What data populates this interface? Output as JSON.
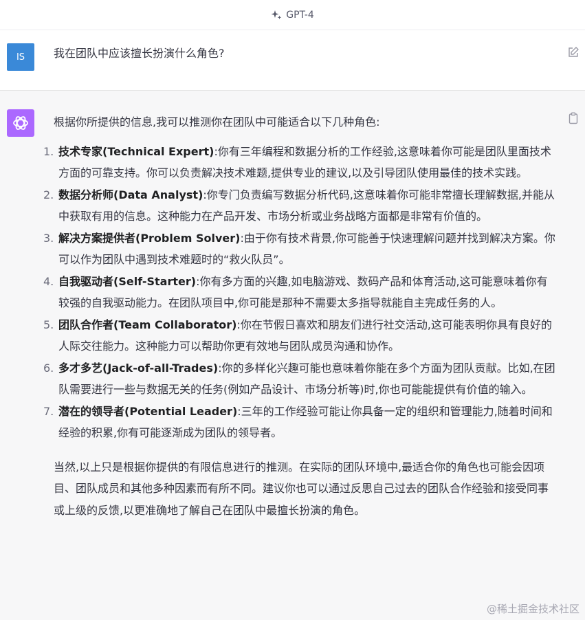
{
  "header": {
    "model_name": "GPT-4"
  },
  "user_message": {
    "avatar_initials": "IS",
    "text": "我在团队中应该擅长扮演什么角色?"
  },
  "assistant_message": {
    "intro": "根据你所提供的信息,我可以推测你在团队中可能适合以下几种角色:",
    "items": [
      {
        "num": "1.",
        "title": "技术专家(Technical Expert)",
        "text": ":你有三年编程和数据分析的工作经验,这意味着你可能是团队里面技术方面的可靠支持。你可以负责解决技术难题,提供专业的建议,以及引导团队使用最佳的技术实践。"
      },
      {
        "num": "2.",
        "title": "数据分析师(Data Analyst)",
        "text": ":你专门负责编写数据分析代码,这意味着你可能非常擅长理解数据,并能从中获取有用的信息。这种能力在产品开发、市场分析或业务战略方面都是非常有价值的。"
      },
      {
        "num": "3.",
        "title": "解决方案提供者(Problem Solver)",
        "text": ":由于你有技术背景,你可能善于快速理解问题并找到解决方案。你可以作为团队中遇到技术难题时的“救火队员”。"
      },
      {
        "num": "4.",
        "title": "自我驱动者(Self-Starter)",
        "text": ":你有多方面的兴趣,如电脑游戏、数码产品和体育活动,这可能意味着你有较强的自我驱动能力。在团队项目中,你可能是那种不需要太多指导就能自主完成任务的人。"
      },
      {
        "num": "5.",
        "title": "团队合作者(Team Collaborator)",
        "text": ":你在节假日喜欢和朋友们进行社交活动,这可能表明你具有良好的人际交往能力。这种能力可以帮助你更有效地与团队成员沟通和协作。"
      },
      {
        "num": "6.",
        "title": "多才多艺(Jack-of-all-Trades)",
        "text": ":你的多样化兴趣可能也意味着你能在多个方面为团队贡献。比如,在团队需要进行一些与数据无关的任务(例如产品设计、市场分析等)时,你也可能能提供有价值的输入。"
      },
      {
        "num": "7.",
        "title": "潜在的领导者(Potential Leader)",
        "text": ":三年的工作经验可能让你具备一定的组织和管理能力,随着时间和经验的积累,你有可能逐渐成为团队的领导者。"
      }
    ],
    "conclusion": "当然,以上只是根据你提供的有限信息进行的推测。在实际的团队环境中,最适合你的角色也可能会因项目、团队成员和其他多种因素而有所不同。建议你也可以通过反思自己过去的团队合作经验和接受同事或上级的反馈,以更准确地了解自己在团队中最擅长扮演的角色。"
  },
  "watermark": "@稀土掘金技术社区"
}
